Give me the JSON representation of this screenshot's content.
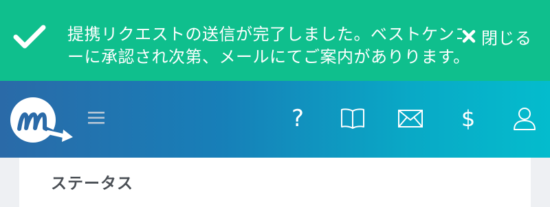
{
  "notification": {
    "message": "提携リクエストの送信が完了しました。ベストケンコーに承認され次第、メールにてご案内がありります。",
    "close_label": "閉じる",
    "background_color": "#0fbf8d"
  },
  "header": {
    "logo_icon": "m-arrow-logo",
    "menu_icon": "hamburger-icon",
    "nav_items": [
      {
        "name": "help",
        "icon": "question-icon",
        "glyph": "?"
      },
      {
        "name": "guide",
        "icon": "book-icon"
      },
      {
        "name": "mail",
        "icon": "envelope-icon"
      },
      {
        "name": "billing",
        "icon": "dollar-icon",
        "glyph": "$"
      },
      {
        "name": "account",
        "icon": "user-icon"
      }
    ],
    "gradient_colors": [
      "#2a6aa8",
      "#04bccd"
    ]
  },
  "content": {
    "section_title": "ステータス"
  }
}
